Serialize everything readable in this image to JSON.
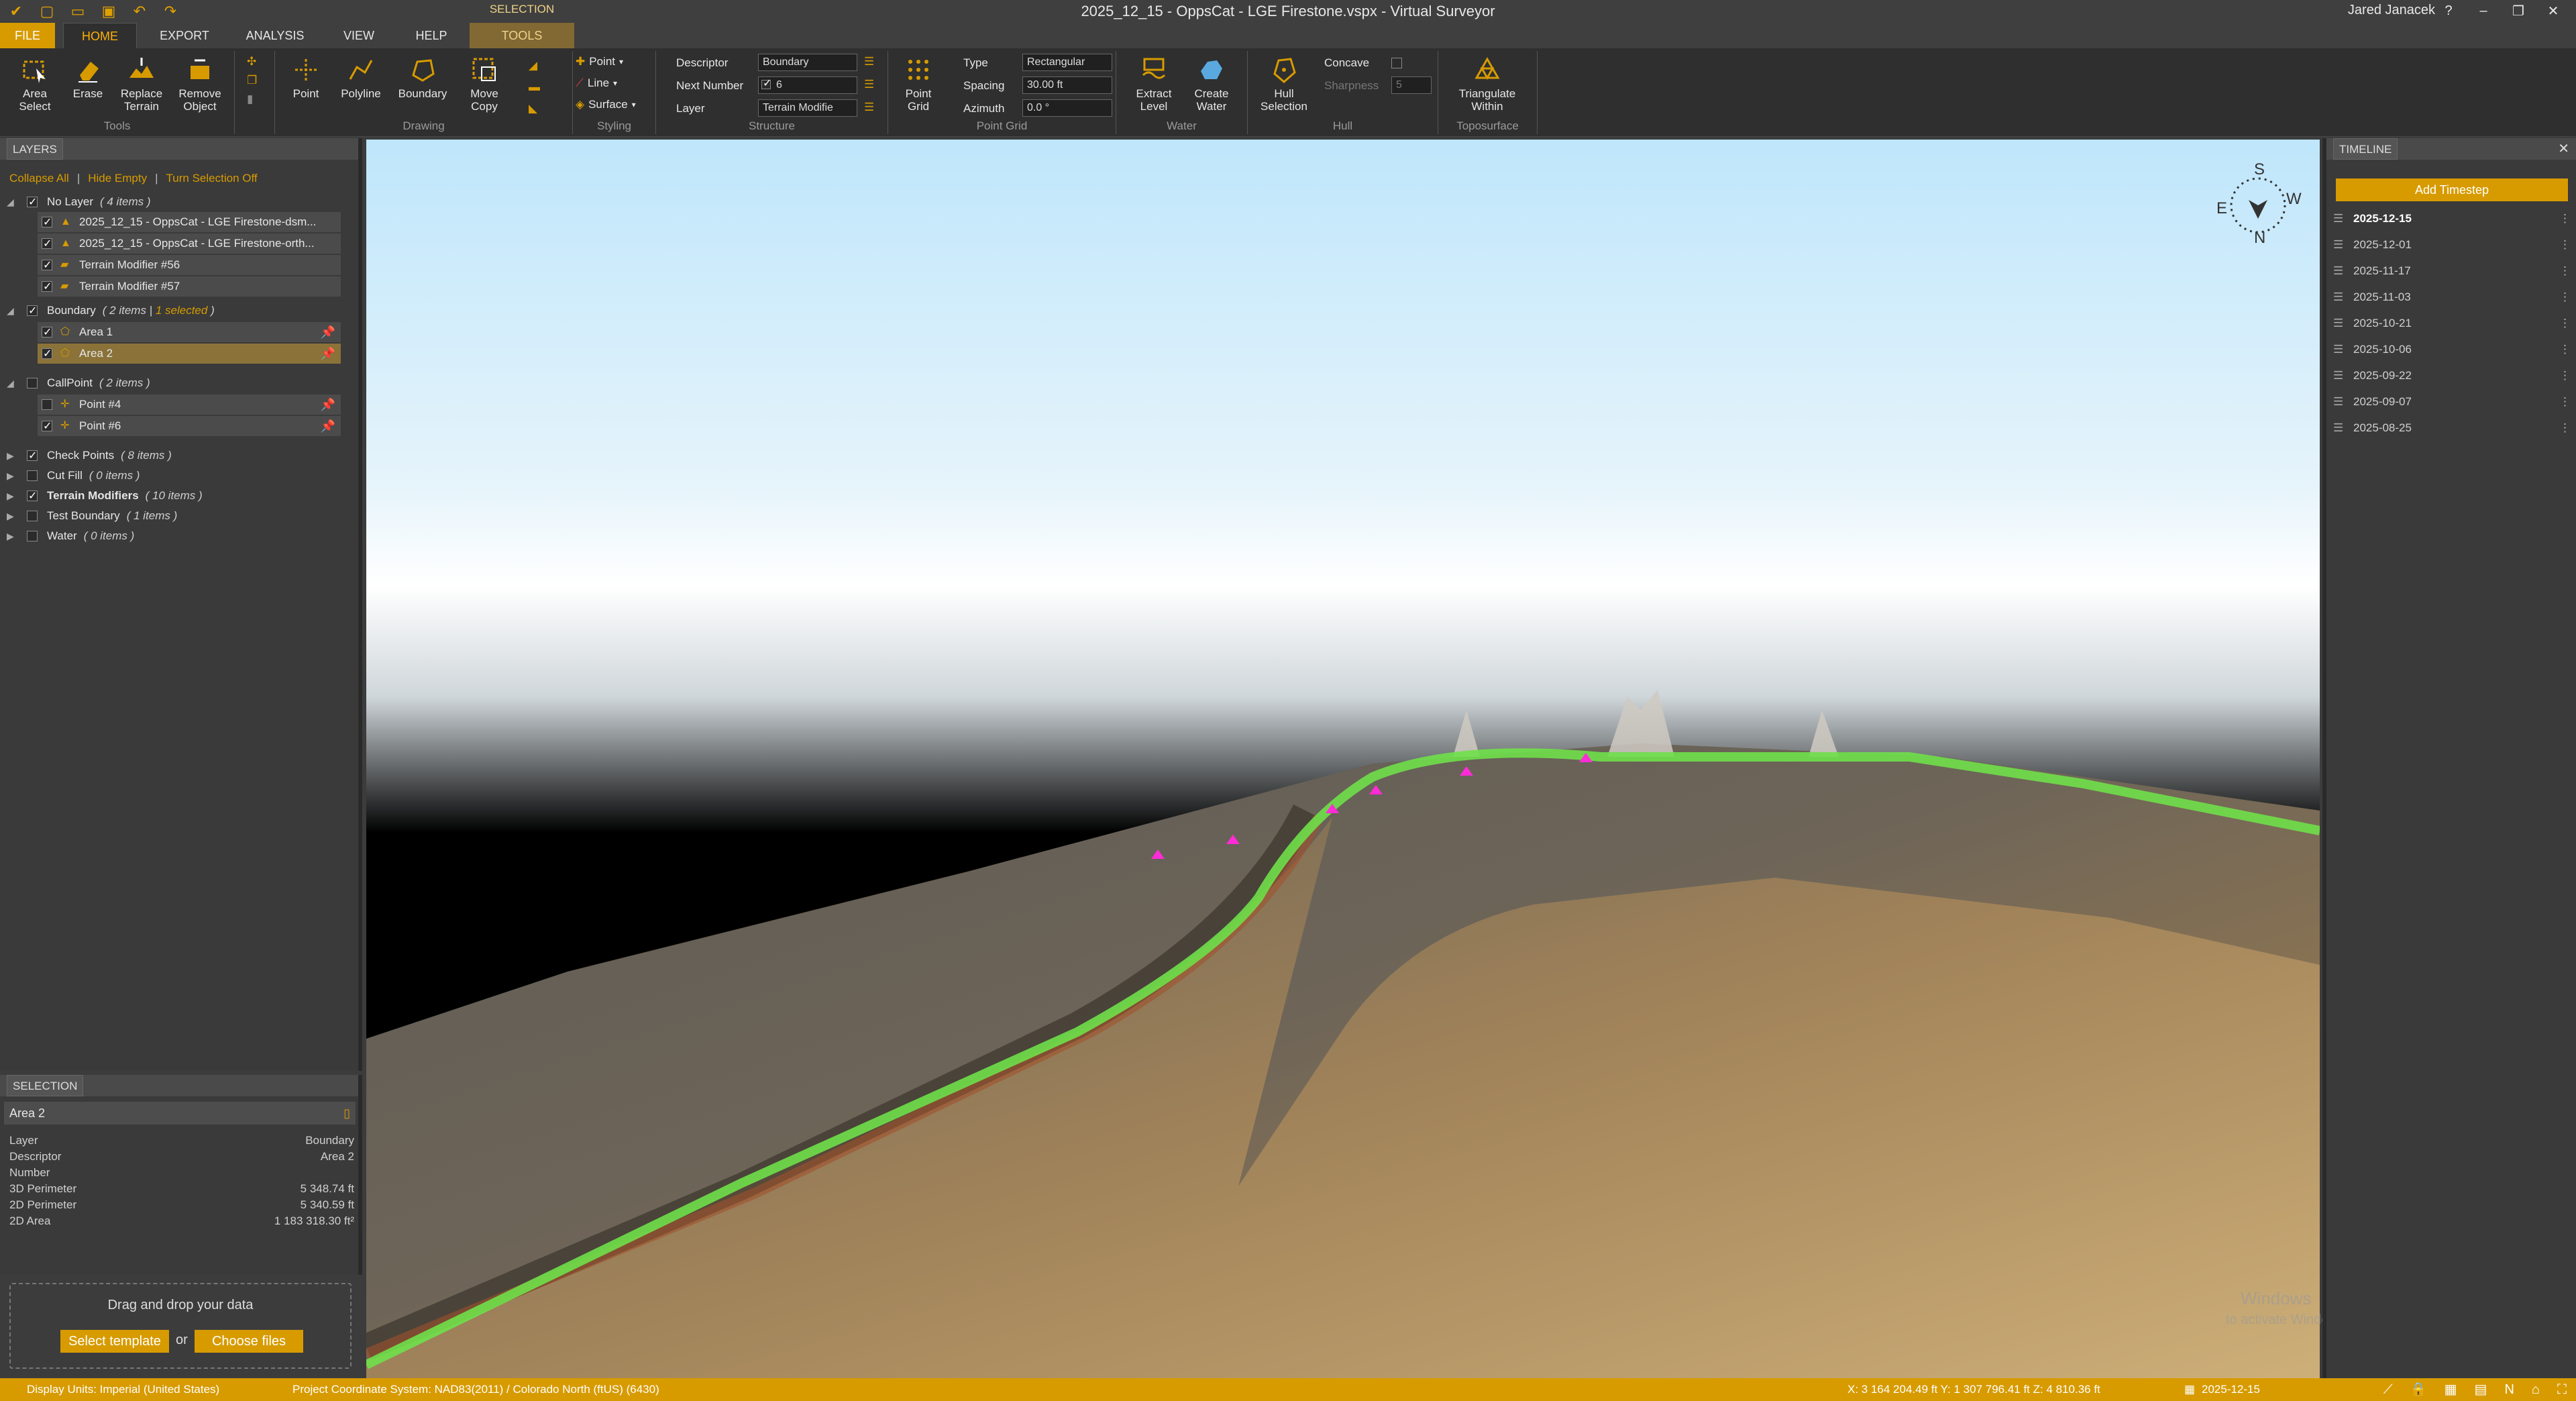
{
  "window": {
    "title": "2025_12_15 - OppsCat - LGE Firestone.vspx  -  Virtual Surveyor",
    "user": "Jared Janacek"
  },
  "tabs": {
    "file": "FILE",
    "home": "HOME",
    "export": "EXPORT",
    "analysis": "ANALYSIS",
    "view": "VIEW",
    "help": "HELP",
    "context_group": "SELECTION",
    "tools": "TOOLS"
  },
  "ribbon": {
    "tools_group": "Tools",
    "area_select": "Area Select",
    "erase": "Erase",
    "replace_terrain": "Replace Terrain",
    "remove_object": "Remove Object",
    "drawing_group": "Drawing",
    "point": "Point",
    "polyline": "Polyline",
    "boundary": "Boundary",
    "move_copy": "Move Copy",
    "styling_group": "Styling",
    "style_point": "Point",
    "style_line": "Line",
    "style_surface": "Surface",
    "structure_group": "Structure",
    "descriptor_label": "Descriptor",
    "descriptor_value": "Boundary",
    "next_number_label": "Next Number",
    "next_number_value": "6",
    "layer_label": "Layer",
    "layer_value": "Terrain Modifie",
    "point_grid_group": "Point Grid",
    "point_grid": "Point Grid",
    "type_label": "Type",
    "type_value": "Rectangular",
    "spacing_label": "Spacing",
    "spacing_value": "30.00 ft",
    "azimuth_label": "Azimuth",
    "azimuth_value": "0.0 °",
    "water_group": "Water",
    "extract_level": "Extract Level",
    "create_water": "Create Water",
    "hull_group": "Hull",
    "hull_selection": "Hull Selection",
    "concave_label": "Concave",
    "sharpness_label": "Sharpness",
    "sharpness_value": "5",
    "toposurface_group": "Toposurface",
    "triangulate_within": "Triangulate Within"
  },
  "layers": {
    "panel_title": "LAYERS",
    "collapse_all": "Collapse All",
    "hide_empty": "Hide Empty",
    "turn_selection_off": "Turn Selection Off",
    "groups": [
      {
        "name": "No Layer",
        "count": "( 4 items )",
        "checked": true,
        "expanded": true,
        "items": [
          "2025_12_15 - OppsCat - LGE Firestone-dsm...",
          "2025_12_15 - OppsCat - LGE Firestone-orth...",
          "Terrain Modifier #56",
          "Terrain Modifier #57"
        ]
      },
      {
        "name": "Boundary",
        "count": "( 2 items |",
        "selected_note": "1 selected",
        "count_end": ")",
        "checked": true,
        "expanded": true,
        "items": [
          "Area 1",
          "Area 2"
        ]
      },
      {
        "name": "CallPoint",
        "count": "( 2 items )",
        "checked": false,
        "expanded": true,
        "items": [
          "Point #4",
          "Point #6"
        ]
      },
      {
        "name": "Check Points",
        "count": "( 8 items )",
        "checked": true
      },
      {
        "name": "Cut Fill",
        "count": "( 0 items )",
        "checked": false
      },
      {
        "name": "Terrain Modifiers",
        "count": "( 10 items )",
        "checked": true
      },
      {
        "name": "Test Boundary",
        "count": "( 1 items )",
        "checked": false
      },
      {
        "name": "Water",
        "count": "( 0 items )",
        "checked": false
      }
    ]
  },
  "selection": {
    "panel_title": "SELECTION",
    "name": "Area 2",
    "props": [
      {
        "k": "Layer",
        "v": "Boundary"
      },
      {
        "k": "Descriptor",
        "v": "Area 2"
      },
      {
        "k": "Number",
        "v": ""
      },
      {
        "k": "3D Perimeter",
        "v": "5 348.74 ft"
      },
      {
        "k": "2D Perimeter",
        "v": "5 340.59 ft"
      },
      {
        "k": "2D Area",
        "v": "1 183 318.30 ft²"
      }
    ]
  },
  "dropzone": {
    "text": "Drag and drop your data",
    "select_template": "Select template",
    "or": "or",
    "choose_files": "Choose files"
  },
  "compass": {
    "n": "N",
    "s": "S",
    "e": "E",
    "w": "W"
  },
  "watermark": {
    "line1": "Windows",
    "line2": "to activate Windows."
  },
  "timeline": {
    "panel_title": "TIMELINE",
    "add_timestep": "Add Timestep",
    "dates": [
      "2025-12-15",
      "2025-12-01",
      "2025-11-17",
      "2025-11-03",
      "2025-10-21",
      "2025-10-06",
      "2025-09-22",
      "2025-09-07",
      "2025-08-25"
    ]
  },
  "status": {
    "units": "Display Units:  Imperial (United States)",
    "crs": "Project Coordinate System:  NAD83(2011) / Colorado North (ftUS) (6430)",
    "coords": "X: 3 164 204.49 ft    Y: 1 307 796.41 ft    Z: 4 810.36 ft",
    "date": "2025-12-15"
  },
  "colors": {
    "accent": "#d79b00",
    "boundary_line": "#6fe04a",
    "point_marker": "#ff2bd6"
  }
}
